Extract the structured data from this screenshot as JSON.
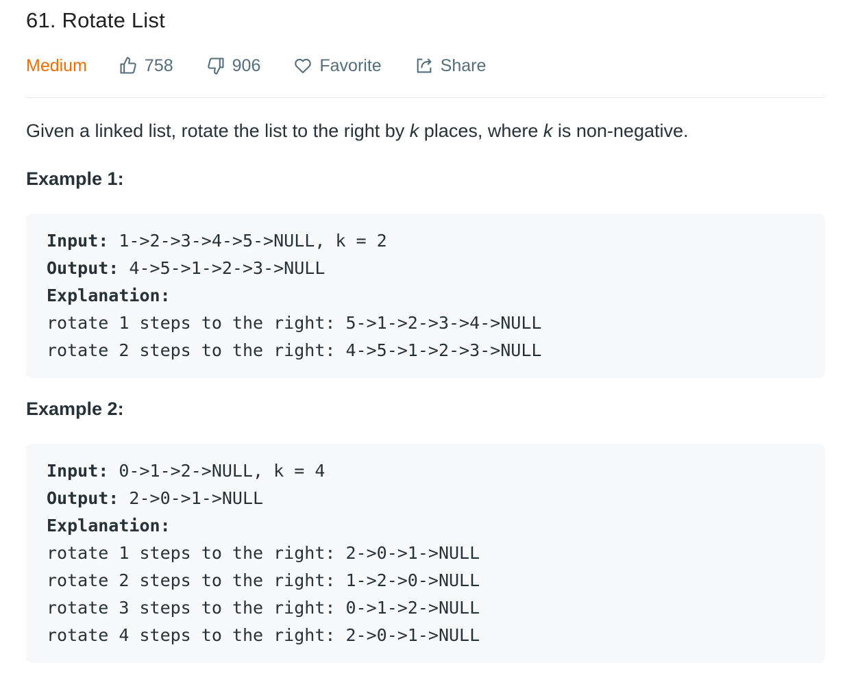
{
  "problem": {
    "title": "61. Rotate List",
    "difficulty": "Medium",
    "likes": "758",
    "dislikes": "906",
    "favorite_label": "Favorite",
    "share_label": "Share",
    "description_parts": [
      "Given a linked list, rotate the list to the right by ",
      "k",
      " places, where ",
      "k",
      " is non-negative."
    ]
  },
  "examples": [
    {
      "heading": "Example 1:",
      "input_label": "Input:",
      "input_value": " 1->2->3->4->5->NULL, k = 2",
      "output_label": "Output:",
      "output_value": " 4->5->1->2->3->NULL",
      "explanation_label": "Explanation:",
      "steps": [
        "rotate 1 steps to the right: 5->1->2->3->4->NULL",
        "rotate 2 steps to the right: 4->5->1->2->3->NULL"
      ]
    },
    {
      "heading": "Example 2:",
      "input_label": "Input:",
      "input_value": " 0->1->2->NULL, k = 4",
      "output_label": "Output:",
      "output_value": " 2->0->1->NULL",
      "explanation_label": "Explanation:",
      "steps": [
        "rotate 1 steps to the right: 2->0->1->NULL",
        "rotate 2 steps to the right: 1->2->0->NULL",
        "rotate 3 steps to the right: 0->1->2->NULL",
        "rotate 4 steps to the right: 2->0->1->NULL"
      ]
    }
  ],
  "colors": {
    "difficulty_medium": "#ef6c00",
    "meta_text": "#546e7a",
    "code_background": "#f7f9fa"
  },
  "icons": {
    "likes": "thumbs-up-icon",
    "dislikes": "thumbs-down-icon",
    "favorite": "heart-icon",
    "share": "share-icon"
  }
}
